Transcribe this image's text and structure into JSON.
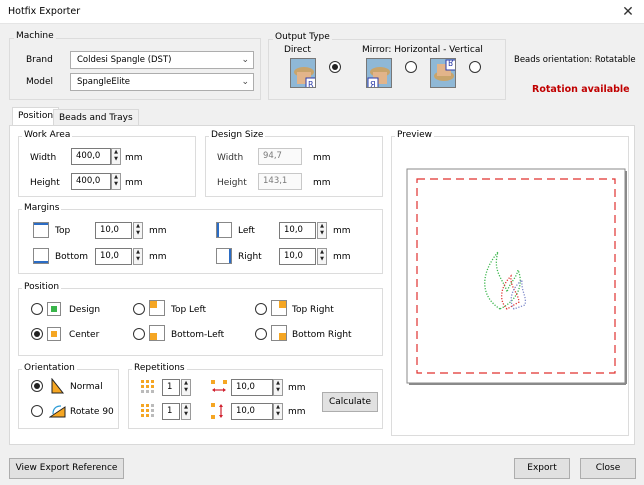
{
  "window": {
    "title": "Hotfix Exporter",
    "close_glyph": "✕"
  },
  "machine": {
    "label": "Machine",
    "brand_label": "Brand",
    "brand_value": "Coldesi Spangle (DST)",
    "model_label": "Model",
    "model_value": "SpangleElite"
  },
  "output_type": {
    "label": "Output Type",
    "direct_label": "Direct",
    "mirror_label": "Mirror: Horizontal - Vertical",
    "selected": "direct"
  },
  "beads_orientation": "Beads orientation: Rotatable",
  "rotation_status": {
    "text": "Rotation available",
    "color": "#c00000"
  },
  "tabs": [
    {
      "label": "Position",
      "active": true
    },
    {
      "label": "Beads and Trays",
      "active": false
    }
  ],
  "work_area": {
    "label": "Work Area",
    "width_label": "Width",
    "width_value": "400,0",
    "width_unit": "mm",
    "height_label": "Height",
    "height_value": "400,0",
    "height_unit": "mm"
  },
  "design_size": {
    "label": "Design Size",
    "width_label": "Width",
    "width_value": "94,7",
    "width_unit": "mm",
    "height_label": "Height",
    "height_value": "143,1",
    "height_unit": "mm"
  },
  "margins": {
    "label": "Margins",
    "top_label": "Top",
    "top_value": "10,0",
    "bottom_label": "Bottom",
    "bottom_value": "10,0",
    "left_label": "Left",
    "left_value": "10,0",
    "right_label": "Right",
    "right_value": "10,0",
    "unit": "mm"
  },
  "position": {
    "label": "Position",
    "options": {
      "design": "Design",
      "top_left": "Top Left",
      "top_right": "Top Right",
      "center": "Center",
      "bottom_left": "Bottom-Left",
      "bottom_right": "Bottom Right"
    },
    "selected": "center"
  },
  "orientation": {
    "label": "Orientation",
    "normal_label": "Normal",
    "rotate_label": "Rotate 90",
    "selected": "normal"
  },
  "repetitions": {
    "label": "Repetitions",
    "cols_value": "1",
    "rows_value": "1",
    "h_spacing_value": "10,0",
    "v_spacing_value": "10,0",
    "unit": "mm",
    "calculate_label": "Calculate"
  },
  "preview": {
    "label": "Preview"
  },
  "footer": {
    "view_export_reference": "View Export Reference",
    "export": "Export",
    "close": "Close"
  },
  "icons": {
    "spin_up": "▲",
    "spin_down": "▼",
    "combo_arrow": "⌵"
  },
  "colors": {
    "accent_orange": "#f5a623",
    "accent_green": "#39b54a",
    "margin_blue": "#2b6cc4",
    "preview_dash": "#e0312f"
  }
}
